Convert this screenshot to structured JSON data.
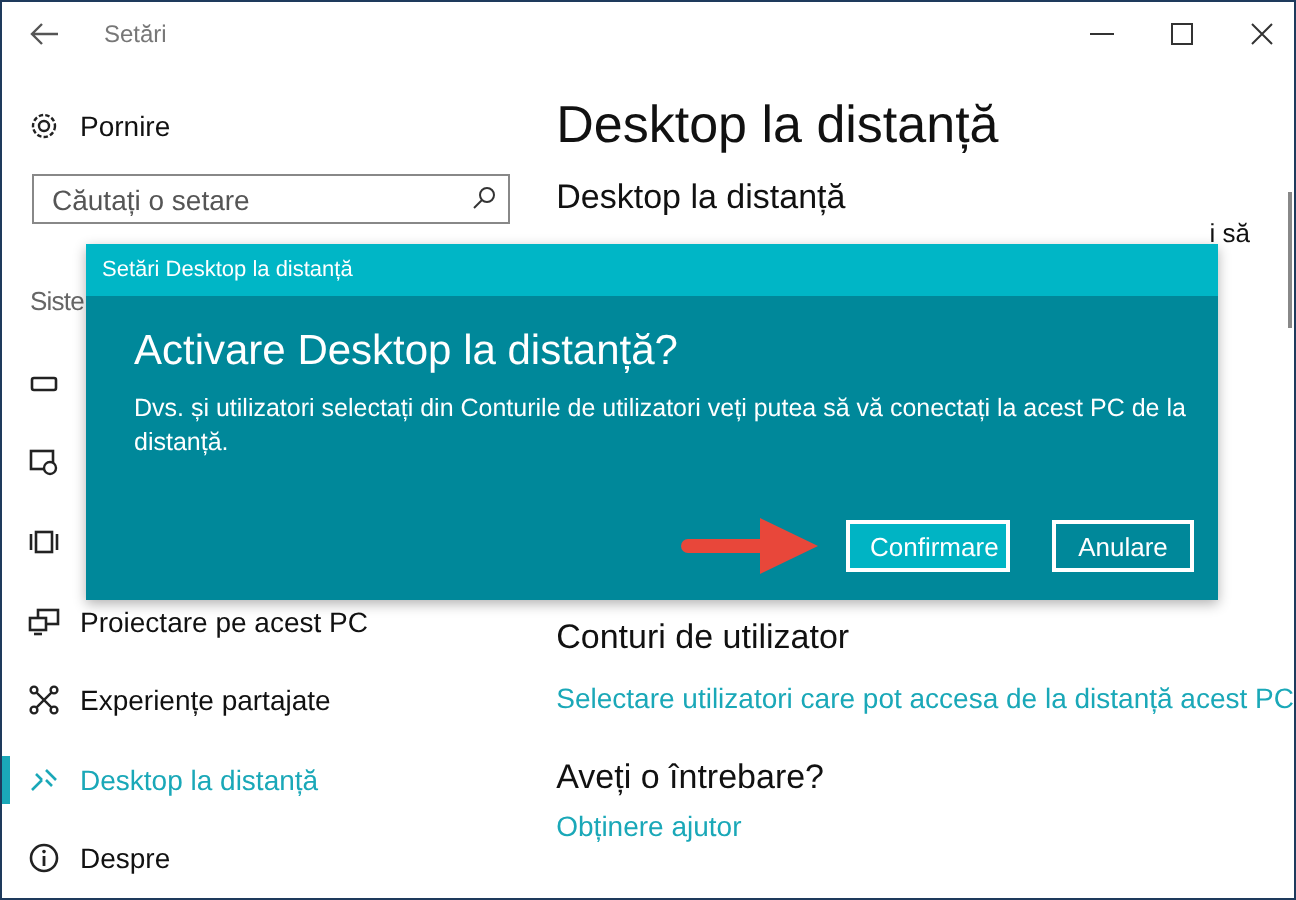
{
  "window": {
    "title": "Setări"
  },
  "sidebar": {
    "home": {
      "label": "Pornire"
    },
    "search": {
      "placeholder": "Căutați o setare"
    },
    "section": "Siste",
    "items": [
      {
        "selected": false
      },
      {
        "selected": false
      },
      {
        "selected": false
      },
      {
        "label": "Proiectare pe acest PC",
        "selected": false
      },
      {
        "label": "Experiențe partajate",
        "selected": false
      },
      {
        "label": "Desktop la distanță",
        "selected": true
      },
      {
        "label": "Despre",
        "selected": false
      }
    ]
  },
  "content": {
    "title": "Desktop la distanță",
    "section": "Desktop la distanță",
    "fragment": "i să",
    "accounts": {
      "heading": "Conturi de utilizator",
      "link": "Selectare utilizatori care pot accesa de la distanță acest PC"
    },
    "help": {
      "heading": "Aveți o întrebare?",
      "link": "Obținere ajutor"
    }
  },
  "dialog": {
    "title": "Setări Desktop la distanță",
    "heading": "Activare Desktop la distanță?",
    "message": "Dvs. și utilizatori selectați din Conturile de utilizatori veți putea să vă conectați la acest PC de la distanță.",
    "buttons": [
      {
        "label": "Confirmare",
        "kind": "primary"
      },
      {
        "label": "Anulare",
        "kind": "secondary"
      }
    ],
    "arrow": true
  }
}
